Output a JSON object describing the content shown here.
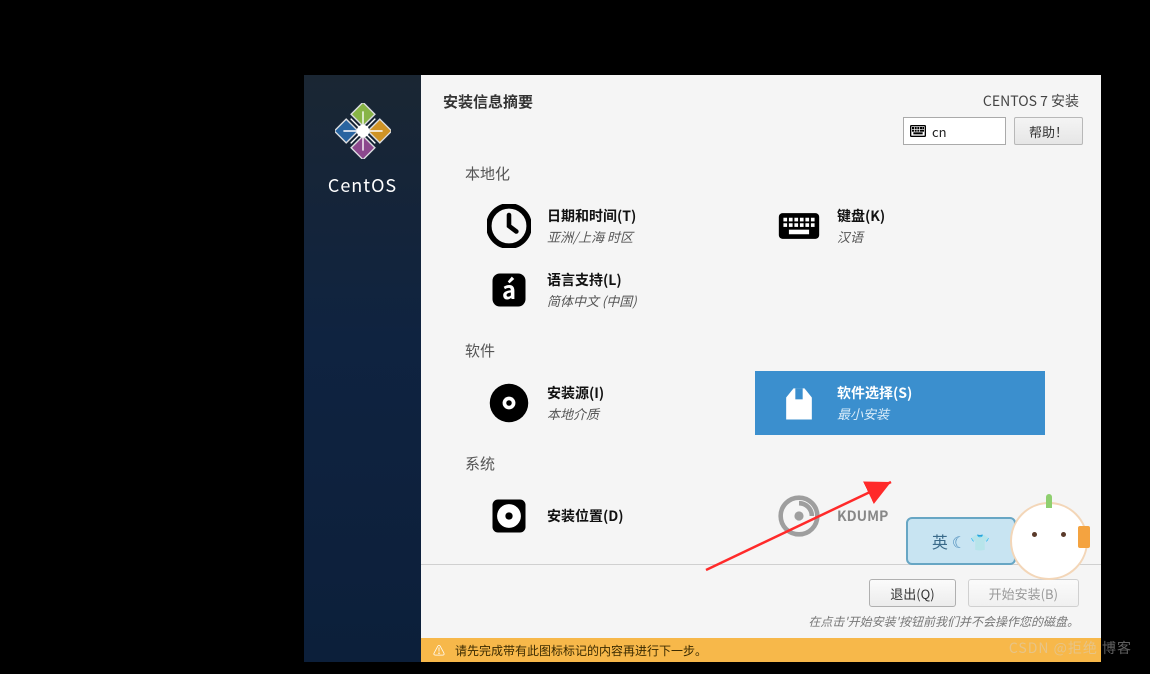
{
  "branding": {
    "name": "CentOS"
  },
  "header": {
    "title": "安装信息摘要",
    "install_label": "CENTOS 7 安装",
    "lang_code": "cn",
    "help_label": "帮助！"
  },
  "categories": [
    {
      "label": "本地化",
      "spokes": [
        {
          "icon": "clock",
          "title": "日期和时间(T)",
          "sub": "亚洲/上海 时区"
        },
        {
          "icon": "keyboard",
          "title": "键盘(K)",
          "sub": "汉语"
        },
        {
          "icon": "lang",
          "title": "语言支持(L)",
          "sub": "简体中文 (中国)"
        }
      ]
    },
    {
      "label": "软件",
      "spokes": [
        {
          "icon": "disc",
          "title": "安装源(I)",
          "sub": "本地介质"
        },
        {
          "icon": "package",
          "title": "软件选择(S)",
          "sub": "最小安装",
          "selected": true
        }
      ]
    },
    {
      "label": "系统",
      "spokes": [
        {
          "icon": "disk",
          "title": "安装位置(D)",
          "sub": ""
        },
        {
          "icon": "kdump",
          "title": "KDUMP",
          "sub": "",
          "disabled": true
        }
      ]
    }
  ],
  "footer": {
    "quit": "退出(Q)",
    "begin": "开始安装(B)",
    "disclaimer": "在点击'开始安装'按钮前我们并不会操作您的磁盘。"
  },
  "warning": "请先完成带有此图标标记的内容再进行下一步。",
  "mascot": {
    "text": "英"
  },
  "watermark": "CSDN @拒绝 博客"
}
